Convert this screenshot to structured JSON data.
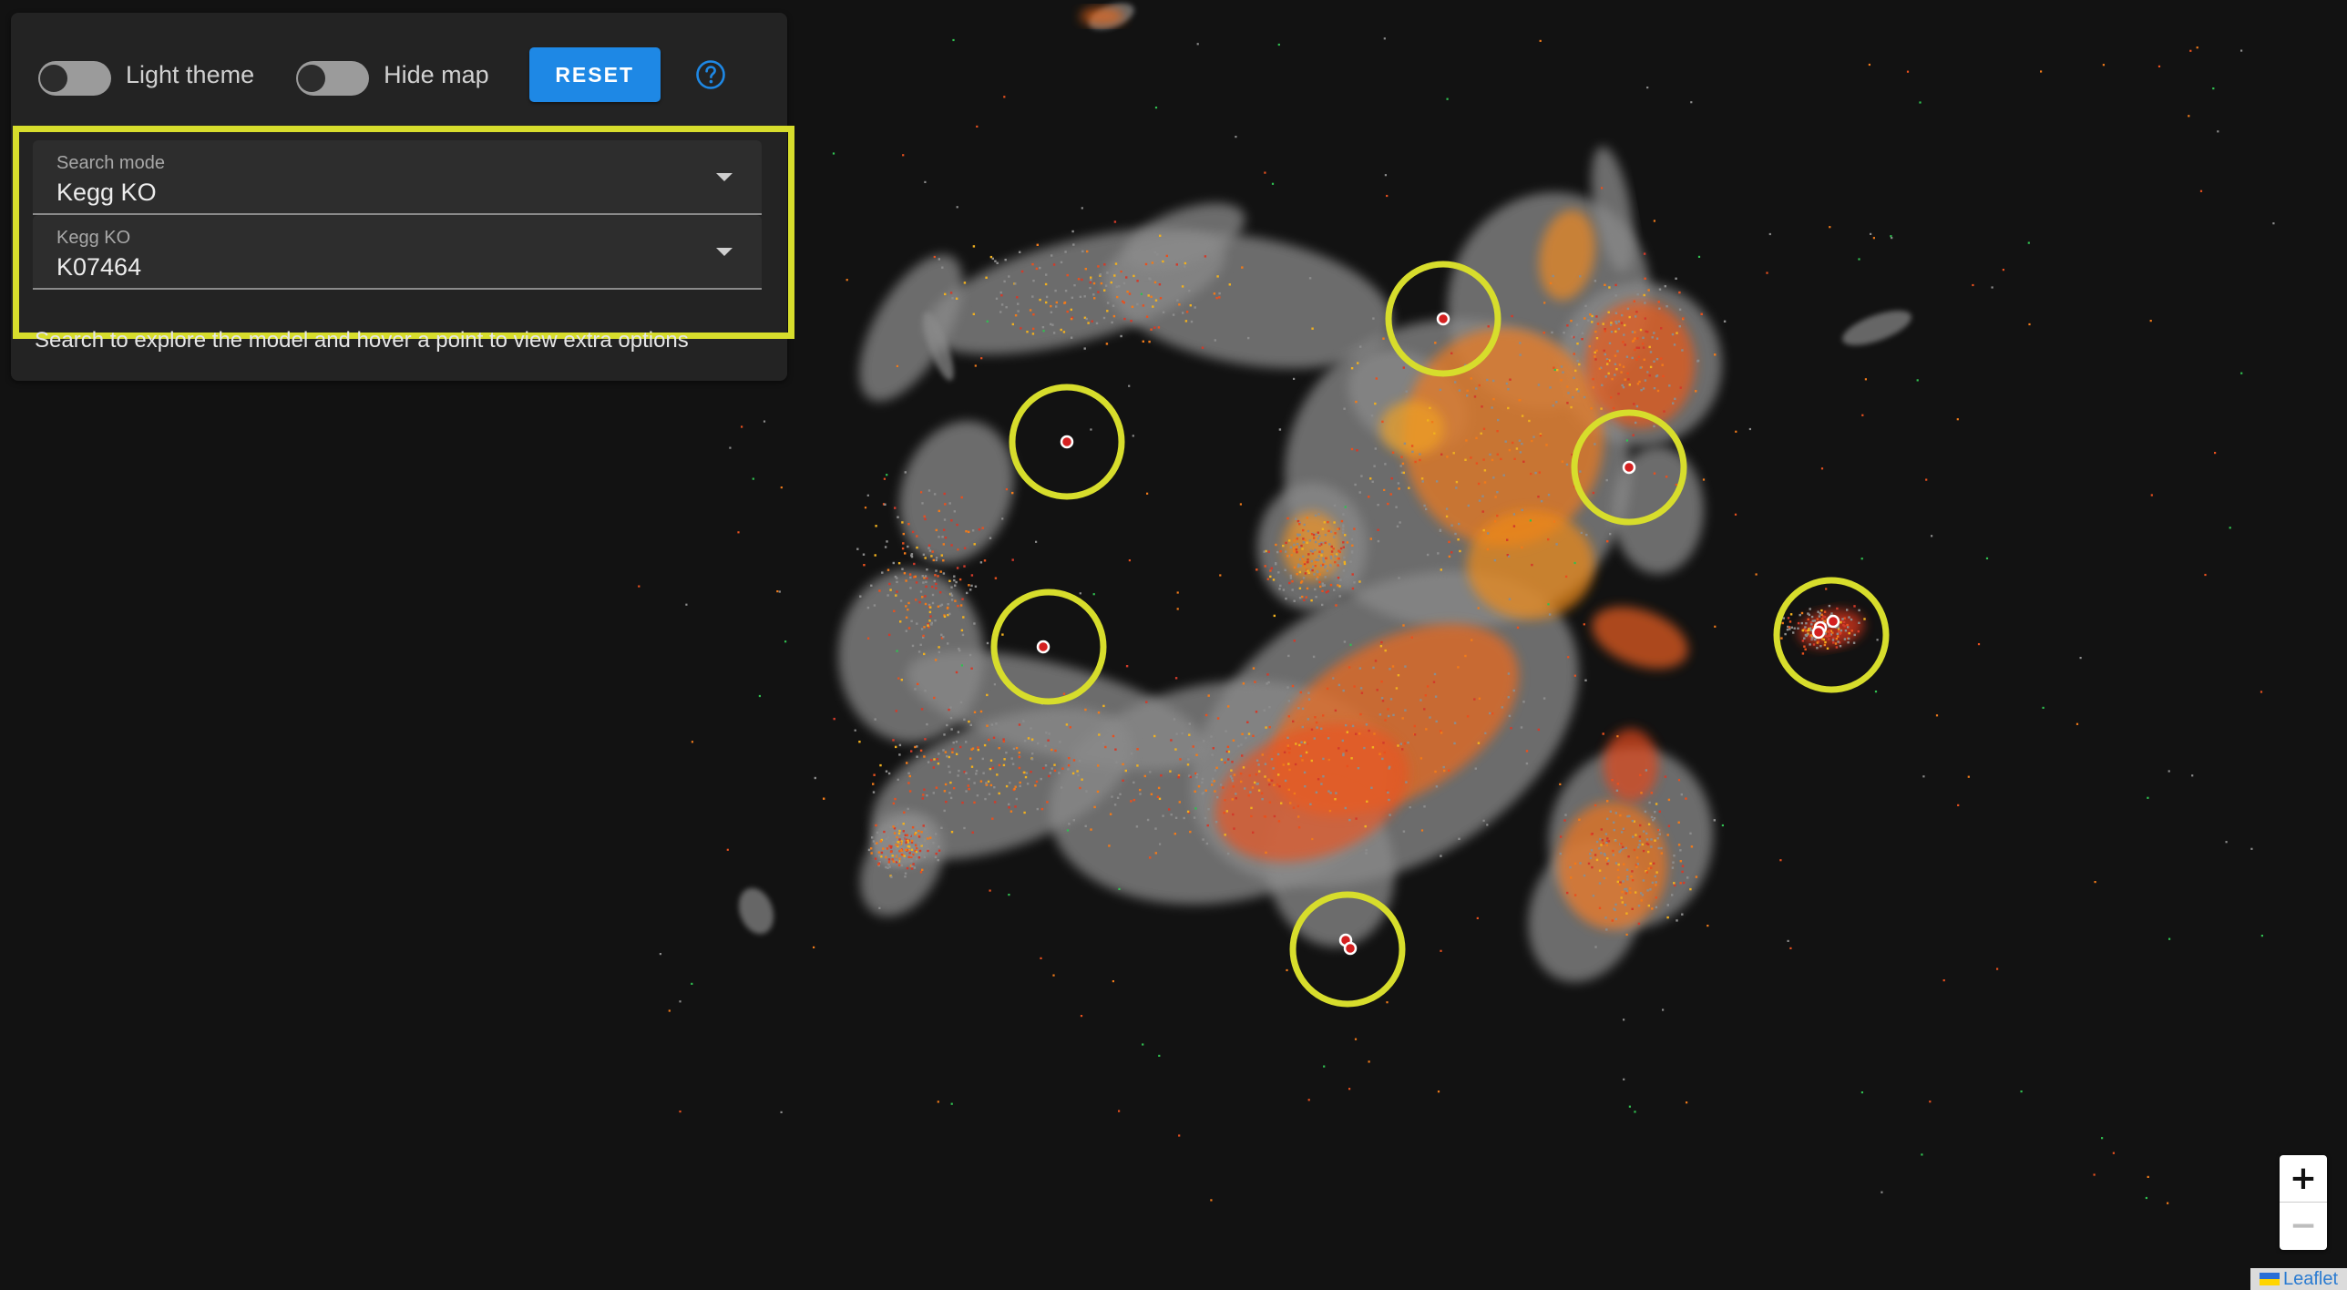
{
  "controls": {
    "light_theme_label": "Light theme",
    "hide_map_label": "Hide map",
    "reset_label": "RESET",
    "help_icon": "help-circle-icon"
  },
  "search": {
    "mode_label": "Search mode",
    "mode_value": "Kegg KO",
    "ko_label": "Kegg KO",
    "ko_value": "K07464",
    "hint": "Search to explore the model and hover a point to view extra options"
  },
  "map": {
    "highlight_color": "#d7dd2c",
    "hit_marker_color": "#d42020"
  },
  "zoom": {
    "in_label": "+",
    "out_label": "−"
  },
  "attribution": {
    "text": "Leaflet"
  }
}
